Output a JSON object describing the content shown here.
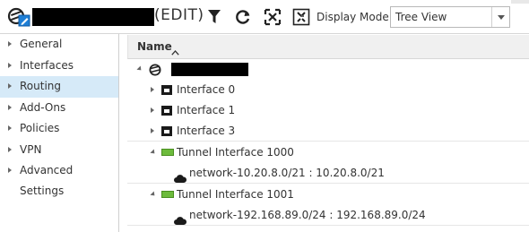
{
  "toolbar": {
    "edit_suffix": "(EDIT)",
    "display_mode_label": "Display Mode:",
    "display_mode_value": "Tree View"
  },
  "sidebar": {
    "items": [
      {
        "label": "General"
      },
      {
        "label": "Interfaces"
      },
      {
        "label": "Routing",
        "active": true
      },
      {
        "label": "Add-Ons"
      },
      {
        "label": "Policies"
      },
      {
        "label": "VPN"
      },
      {
        "label": "Advanced Settings"
      }
    ]
  },
  "tree": {
    "column_header": "Name",
    "interfaces": [
      {
        "label": "Interface 0"
      },
      {
        "label": "Interface 1"
      },
      {
        "label": "Interface 3"
      }
    ],
    "tunnels": [
      {
        "label": "Tunnel Interface 1000",
        "network": "network-10.20.8.0/21 : 10.20.8.0/21"
      },
      {
        "label": "Tunnel Interface 1001",
        "network": "network-192.168.89.0/24 : 192.168.89.0/24"
      }
    ]
  },
  "colors": {
    "active_nav_bg": "#d6eaf8",
    "tunnel_green": "#6dbb3c",
    "header_bg": "#f0f0f0",
    "edit_icon_blue": "#1e7fd6"
  }
}
